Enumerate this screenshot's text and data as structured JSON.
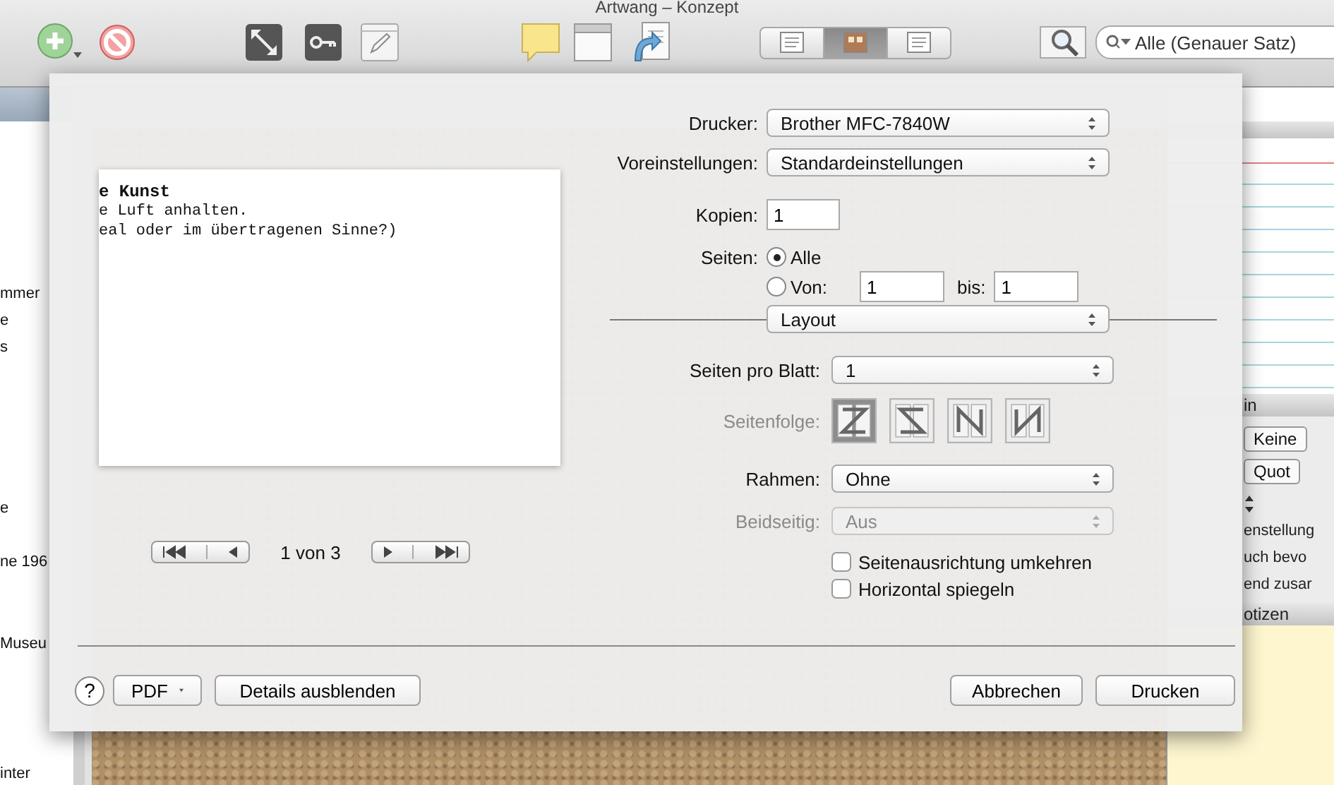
{
  "window": {
    "title": "Artwang – Konzept"
  },
  "toolbar": {
    "views": [
      {
        "selected": false
      },
      {
        "selected": true
      },
      {
        "selected": false
      }
    ],
    "search": {
      "placeholder": "Alle (Genauer Satz)"
    }
  },
  "binder": {
    "items": [
      "mmer",
      "e",
      "s",
      "e",
      "ne 196",
      "Museu",
      "inter"
    ]
  },
  "inspector": {
    "general_header": "in",
    "fields": [
      {
        "kind": "popup",
        "value": "Keine"
      },
      {
        "kind": "popup",
        "value": "Quot"
      },
      {
        "kind": "stepper"
      },
      {
        "kind": "text",
        "value": "enstellung"
      },
      {
        "kind": "text",
        "value": "uch bevo"
      },
      {
        "kind": "text",
        "value": "end zusar"
      }
    ],
    "notes_header": "otizen"
  },
  "print_dialog": {
    "preview": {
      "heading": "e Kunst",
      "lines": [
        "e Luft anhalten.",
        "eal oder im übertragenen Sinne?)"
      ],
      "pager": "1 von 3"
    },
    "printer": {
      "label": "Drucker:",
      "value": "Brother MFC-7840W"
    },
    "presets": {
      "label": "Voreinstellungen:",
      "value": "Standardeinstellungen"
    },
    "copies": {
      "label": "Kopien:",
      "value": "1"
    },
    "pages": {
      "label": "Seiten:",
      "options": [
        {
          "label": "Alle",
          "selected": true
        },
        {
          "label": "Von:",
          "selected": false
        }
      ],
      "from": "1",
      "to_label": "bis:",
      "to": "1"
    },
    "section": "Layout",
    "settings": [
      {
        "kind": "popup",
        "label": "Seiten pro Blatt:",
        "value": "1",
        "disabled": false
      },
      {
        "kind": "order",
        "label": "Seitenfolge:",
        "options": [
          {
            "selected": true
          },
          {
            "selected": false
          },
          {
            "selected": false
          },
          {
            "selected": false
          }
        ]
      },
      {
        "kind": "popup",
        "label": "Rahmen:",
        "value": "Ohne",
        "disabled": false
      },
      {
        "kind": "popup",
        "label": "Beidseitig:",
        "value": "Aus",
        "disabled": true
      },
      {
        "kind": "checkbox",
        "label": "Seitenausrichtung umkehren",
        "checked": false
      },
      {
        "kind": "checkbox",
        "label": "Horizontal spiegeln",
        "checked": false
      }
    ],
    "buttons": {
      "help": "?",
      "pdf": "PDF",
      "details": "Details ausblenden",
      "cancel": "Abbrechen",
      "print": "Drucken"
    }
  }
}
